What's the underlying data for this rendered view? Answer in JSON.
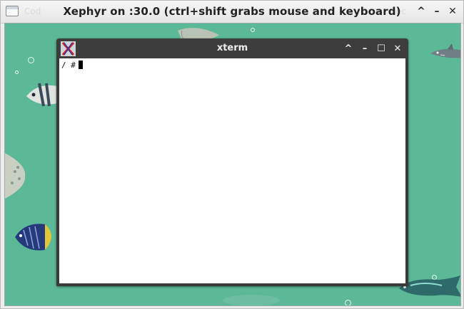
{
  "outer_window": {
    "title": "Xephyr on :30.0 (ctrl+shift grabs mouse and keyboard)",
    "ghost_left": "Cod",
    "ghost_right": "Sec",
    "buttons": {
      "up": "^",
      "minimize": "–",
      "close": "✕"
    }
  },
  "desktop": {
    "background": "#5bb997"
  },
  "xterm": {
    "title": "xterm",
    "prompt": "/ #",
    "buttons": {
      "up": "^",
      "minimize": "–",
      "maximize": "☐",
      "close": "✕"
    }
  },
  "colors": {
    "desktop_bg": "#5bb997",
    "titlebar_dark": "#3d3d3d",
    "terminal_bg": "#ffffff"
  }
}
